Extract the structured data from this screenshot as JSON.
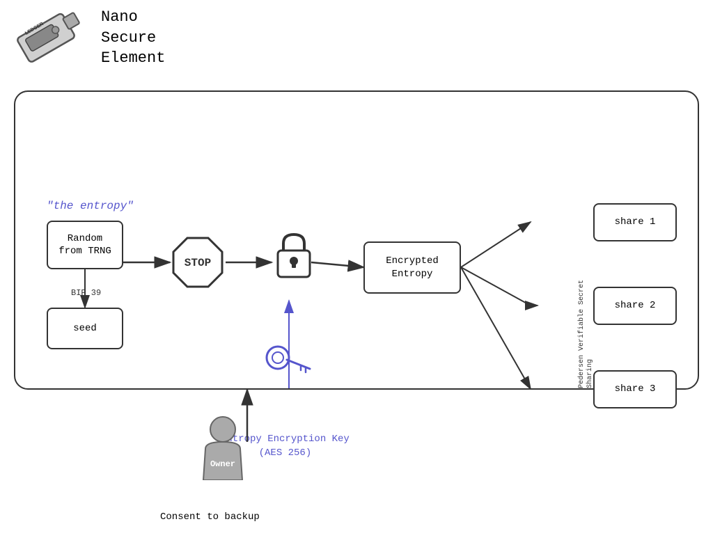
{
  "logo": {
    "device_alt": "Ledger Nano Device",
    "title_line1": "Nano",
    "title_line2": "Secure",
    "title_line3": "Element"
  },
  "diagram": {
    "entropy_label": "\"the entropy\"",
    "boxes": {
      "trng": "Random\nfrom TRNG",
      "seed": "seed",
      "encrypted_entropy": "Encrypted\nEntropy",
      "share1": "share 1",
      "share2": "share 2",
      "share3": "share 3"
    },
    "stop_label": "STOP",
    "bip39_label": "BIP 39",
    "pedersen_label": "Pedersen\nVerifiable Secret\nSharing",
    "key_label": "Entropy Encryption Key\n(AES 256)",
    "owner_label": "Owner",
    "consent_label": "Consent to backup"
  }
}
